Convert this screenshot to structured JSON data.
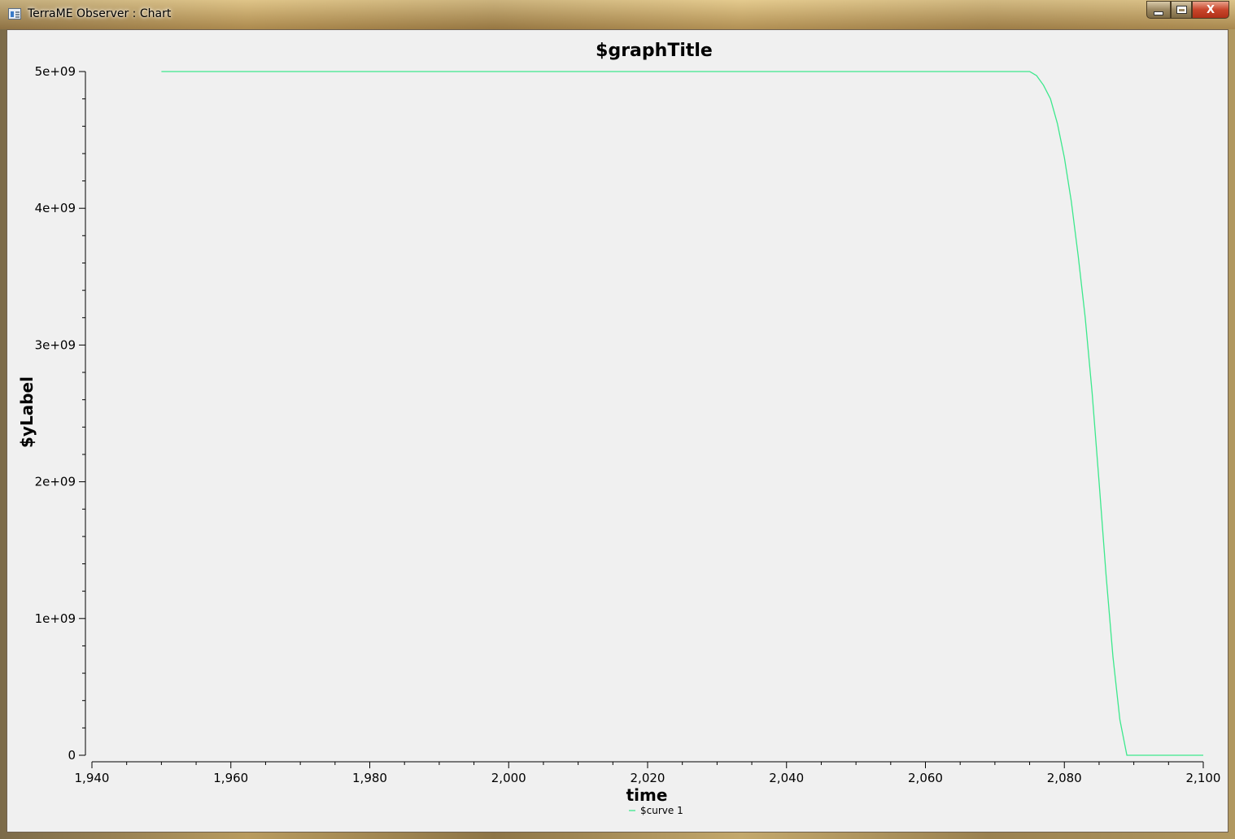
{
  "window": {
    "title": "TerraME Observer : Chart",
    "minimize_icon": "minimize-icon",
    "maximize_icon": "maximize-icon",
    "close_icon": "close-icon",
    "close_glyph": "X"
  },
  "chart_data": {
    "type": "line",
    "title": "$graphTitle",
    "xlabel": "time",
    "ylabel": "$yLabel",
    "xlim": [
      1940,
      2100
    ],
    "ylim": [
      0,
      5000000000
    ],
    "x_ticks": [
      1940,
      1960,
      1980,
      2000,
      2020,
      2040,
      2060,
      2080,
      2100
    ],
    "x_tick_labels": [
      "1,940",
      "1,960",
      "1,980",
      "2,000",
      "2,020",
      "2,040",
      "2,060",
      "2,080",
      "2,100"
    ],
    "y_ticks": [
      0,
      1000000000,
      2000000000,
      3000000000,
      4000000000,
      5000000000
    ],
    "y_tick_labels": [
      "0",
      "1e+09",
      "2e+09",
      "3e+09",
      "4e+09",
      "5e+09"
    ],
    "grid": false,
    "legend": "bottom-center",
    "series": [
      {
        "name": "$curve 1",
        "color": "#3ce88c",
        "x": [
          1950,
          2075,
          2076,
          2077,
          2078,
          2079,
          2080,
          2081,
          2082,
          2083,
          2084,
          2085,
          2086,
          2087,
          2088,
          2089,
          2090,
          2100
        ],
        "y": [
          5000000000,
          5000000000,
          4970000000,
          4900000000,
          4800000000,
          4620000000,
          4370000000,
          4050000000,
          3650000000,
          3200000000,
          2650000000,
          2000000000,
          1320000000,
          720000000,
          260000000,
          0,
          0,
          0
        ]
      }
    ]
  }
}
